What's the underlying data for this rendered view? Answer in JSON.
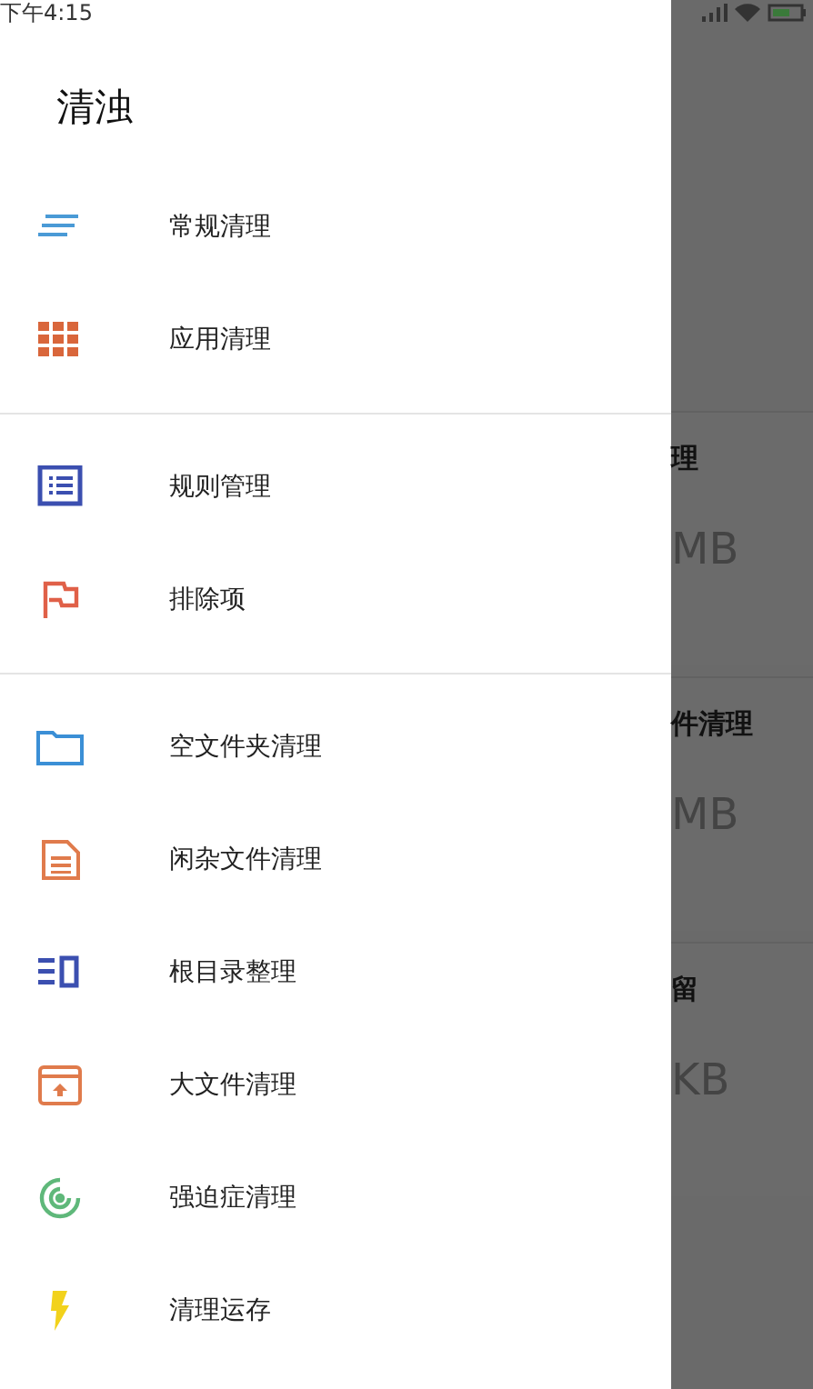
{
  "status_bar": {
    "time": "下午4:15"
  },
  "drawer": {
    "title": "清浊",
    "sections": [
      {
        "items": [
          {
            "kind": "lines",
            "label": "常规清理"
          },
          {
            "kind": "grid",
            "label": "应用清理"
          }
        ]
      },
      {
        "items": [
          {
            "kind": "list",
            "label": "规则管理"
          },
          {
            "kind": "flag",
            "label": "排除项"
          }
        ]
      },
      {
        "items": [
          {
            "kind": "folder",
            "label": "空文件夹清理"
          },
          {
            "kind": "document",
            "label": "闲杂文件清理"
          },
          {
            "kind": "columns",
            "label": "根目录整理"
          },
          {
            "kind": "archive",
            "label": "大文件清理"
          },
          {
            "kind": "target",
            "label": "强迫症清理"
          },
          {
            "kind": "bolt",
            "label": "清理运存"
          }
        ]
      }
    ]
  },
  "background_cards": [
    {
      "title": "理",
      "value": "MB"
    },
    {
      "title": "件清理",
      "value": "MB"
    },
    {
      "title": "留",
      "value": "KB"
    }
  ]
}
